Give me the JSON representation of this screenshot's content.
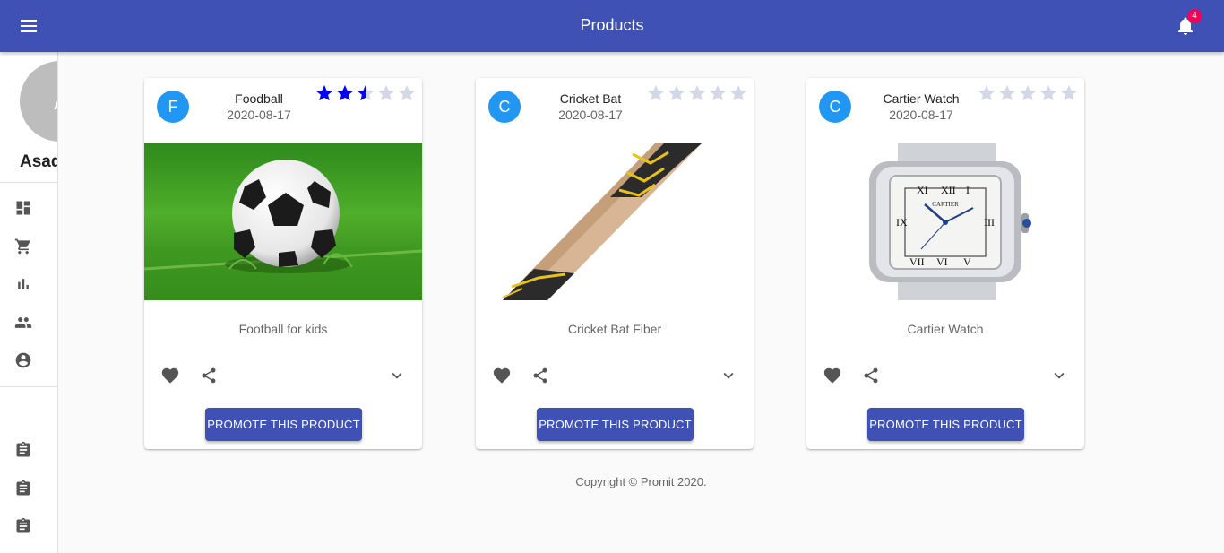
{
  "appbar": {
    "title": "Products",
    "notification_count": "4"
  },
  "drawer": {
    "avatar_initial": "A",
    "username": "Asad",
    "nav_icons": [
      "dashboard-icon",
      "cart-icon",
      "bar-chart-icon",
      "people-icon",
      "account-circle-icon"
    ],
    "clipboard_icons": [
      "clipboard-icon",
      "clipboard-icon",
      "clipboard-icon"
    ]
  },
  "products": [
    {
      "avatar": "F",
      "name": "Foodball",
      "date": "2020-08-17",
      "rating": 2.5,
      "max_rating": 5,
      "description": "Football for kids",
      "promote_label": "PROMOTE THIS PRODUCT"
    },
    {
      "avatar": "C",
      "name": "Cricket Bat",
      "date": "2020-08-17",
      "rating": 0,
      "max_rating": 5,
      "description": "Cricket Bat Fiber",
      "promote_label": "PROMOTE THIS PRODUCT"
    },
    {
      "avatar": "C",
      "name": "Cartier Watch",
      "date": "2020-08-17",
      "rating": 0,
      "max_rating": 5,
      "description": "Cartier Watch",
      "promote_label": "PROMOTE THIS PRODUCT",
      "watch_brand": "CARTIER"
    }
  ],
  "footer": {
    "copyright": "Copyright © Promit 2020."
  },
  "colors": {
    "primary": "#3f51b5",
    "avatar": "#2196f3",
    "star_filled": "#0000ff",
    "star_empty": "#d3d8e6",
    "badge": "#f50057"
  }
}
